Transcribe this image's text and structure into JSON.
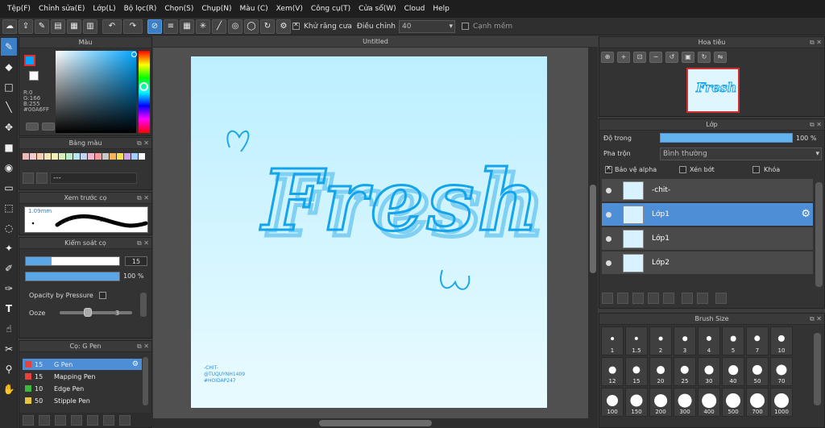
{
  "menu": [
    "Tệp(F)",
    "Chỉnh sửa(E)",
    "Lớp(L)",
    "Bộ lọc(R)",
    "Chọn(S)",
    "Chụp(N)",
    "Màu (C)",
    "Xem(V)",
    "Công cụ(T)",
    "Cửa sổ(W)",
    "Cloud",
    "Help"
  ],
  "toolbar": {
    "antialias_label": "Khử răng cưa",
    "adjust_label": "Điều chỉnh",
    "adjust_value": "40",
    "soft_edge_label": "Cạnh mềm"
  },
  "color_panel": {
    "title": "Màu",
    "r": "R:0",
    "g": "G:166",
    "b": "B:255",
    "hex": "#00A6FF",
    "fg_color": "#00a6ff"
  },
  "palette_panel": {
    "title": "Bảng màu",
    "palette_name": "---",
    "swatches": [
      "#f2b8b8",
      "#f7c9c9",
      "#f5d0b0",
      "#f7e3b5",
      "#f3efb6",
      "#d8f0b8",
      "#bdeccd",
      "#b8e6f0",
      "#c7d3f5",
      "#f0b6d0",
      "#f79a9a",
      "#c8c8c8",
      "#f5b35a",
      "#f5e05a",
      "#d0a0f0",
      "#a0d0ff",
      "#ffffff"
    ]
  },
  "preview_panel": {
    "title": "Xem trước cọ",
    "size": "1.09mm"
  },
  "brush_control": {
    "title": "Kiểm soát cọ",
    "size_value": "15",
    "size_fraction": 0.28,
    "opacity_value": "100 %",
    "opacity_fraction": 1.0,
    "opacity_by_pressure_label": "Opacity by Pressure",
    "ooze_label": "Ooze",
    "ooze_value": "3"
  },
  "brush_list": {
    "title": "Cọ: G Pen",
    "items": [
      {
        "size": "15",
        "name": "G Pen",
        "color": "#e8403a",
        "selected": true
      },
      {
        "size": "15",
        "name": "Mapping Pen",
        "color": "#e8403a",
        "selected": false
      },
      {
        "size": "10",
        "name": "Edge Pen",
        "color": "#3cb83c",
        "selected": false
      },
      {
        "size": "50",
        "name": "Stipple Pen",
        "color": "#e8c63a",
        "selected": false
      }
    ]
  },
  "document": {
    "tab_title": "Untitled",
    "artwork_text": "Fresh",
    "signature": [
      "-CHIT-",
      "@TUQUYNH1409",
      "#HOIDAP247"
    ]
  },
  "navigator": {
    "title": "Hoa tiêu"
  },
  "layer_panel": {
    "title": "Lớp",
    "opacity_label": "Độ trong",
    "opacity_value": "100 %",
    "opacity_fraction": 1.0,
    "blend_label": "Pha trộn",
    "blend_value": "Bình thường",
    "protect_alpha_label": "Bảo vệ alpha",
    "clipping_label": "Xén bớt",
    "lock_label": "Khóa",
    "layers": [
      {
        "name": "-chit-",
        "selected": false
      },
      {
        "name": "Lớp1",
        "selected": true
      },
      {
        "name": "Lớp1",
        "selected": false
      },
      {
        "name": "Lớp2",
        "selected": false
      }
    ]
  },
  "brush_size_panel": {
    "title": "Brush Size",
    "sizes": [
      "1",
      "1.5",
      "2",
      "3",
      "4",
      "5",
      "7",
      "10",
      "12",
      "15",
      "20",
      "25",
      "30",
      "40",
      "50",
      "70",
      "100",
      "150",
      "200",
      "300",
      "400",
      "500",
      "700",
      "1000"
    ]
  },
  "icons": [
    "pen-icon",
    "eraser-icon",
    "fill-icon",
    "select-icon",
    "move-icon",
    "text-icon",
    "hand-icon",
    "eyedropper-icon"
  ]
}
